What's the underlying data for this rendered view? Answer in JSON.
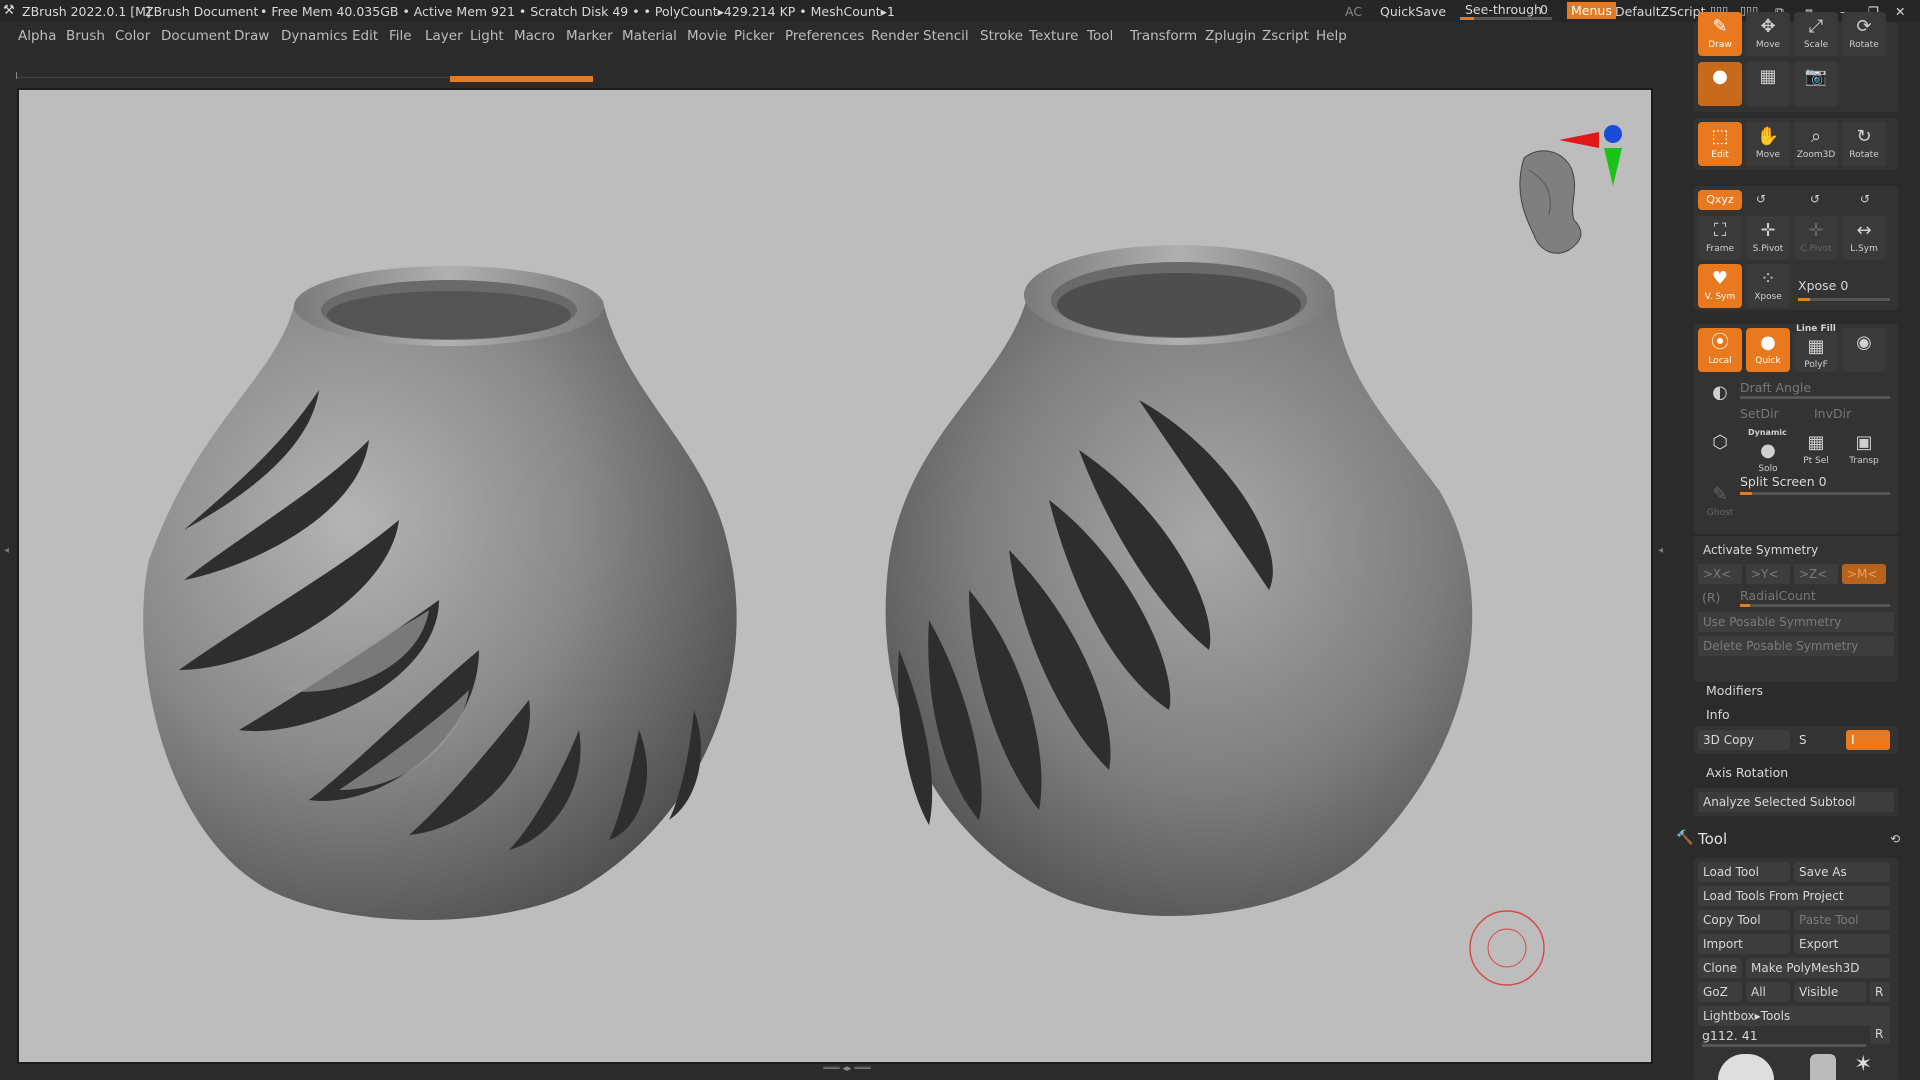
{
  "titlebar": {
    "app": "ZBrush 2022.0.1 [M]",
    "doc": "ZBrush Document",
    "stats": "• Free Mem 40.035GB • Active Mem 921 • Scratch Disk 49 •  • PolyCount▸429.214 KP  • MeshCount▸1",
    "ac": "AC",
    "quicksave": "QuickSave",
    "seethrough": "See-through",
    "seethrough_value": "0",
    "menus": "Menus",
    "script": "DefaultZScript"
  },
  "menubar": [
    "Alpha",
    "Brush",
    "Color",
    "Document",
    "Draw",
    "Dynamics",
    "Edit",
    "File",
    "Layer",
    "Light",
    "Macro",
    "Marker",
    "Material",
    "Movie",
    "Picker",
    "Preferences",
    "Render",
    "Stencil",
    "Stroke",
    "Texture",
    "Tool",
    "Transform",
    "Zplugin",
    "Zscript",
    "Help"
  ],
  "panel": {
    "top_tools": [
      "Draw",
      "Move",
      "Scale",
      "Rotate"
    ],
    "nav_tools": [
      "Edit",
      "Move",
      "Zoom3D",
      "Rotate"
    ],
    "xyz": "Qxyz",
    "frame_tools": [
      "Frame",
      "S.Pivot",
      "C.Pivot",
      "L.Sym"
    ],
    "vsym": "V. Sym",
    "xpose": "Xpose",
    "xpose_label": "Xpose 0",
    "poly_tools": [
      "Local",
      "Quick",
      "PolyF"
    ],
    "linefill": "Line Fill",
    "draft_angle": "Draft Angle",
    "setdir": "SetDir",
    "invdir": "InvDir",
    "dynamic": "Dynamic",
    "solo": "Solo",
    "ptsel": "Pt Sel",
    "transp": "Transp",
    "ghost": "Ghost",
    "split_screen": "Split Screen 0",
    "activate_symmetry": "Activate Symmetry",
    "sym_axes": [
      ">X<",
      ">Y<",
      ">Z<",
      ">M<"
    ],
    "r": "(R)",
    "radialcount": "RadialCount",
    "use_posable": "Use Posable Symmetry",
    "delete_posable": "Delete Posable Symmetry",
    "modifiers": "Modifiers",
    "info": "Info",
    "copy3d": "3D Copy",
    "s": "S",
    "i": "I",
    "axis_rotation": "Axis Rotation",
    "analyze": "Analyze Selected Subtool",
    "tool_title": "Tool",
    "tool_buttons": {
      "load_tool": "Load Tool",
      "save_as": "Save As",
      "load_from_project": "Load Tools From Project",
      "copy_tool": "Copy Tool",
      "paste_tool": "Paste Tool",
      "import": "Import",
      "export": "Export",
      "clone": "Clone",
      "make_polymesh": "Make PolyMesh3D",
      "goz": "GoZ",
      "all": "All",
      "visible": "Visible",
      "r": "R",
      "lightbox": "Lightbox▸Tools",
      "current": "g112. 41",
      "r2": "R"
    }
  },
  "colors": {
    "accent": "#e8791f",
    "canvas": "#bdbdbd",
    "panel": "#2b2b2b"
  }
}
